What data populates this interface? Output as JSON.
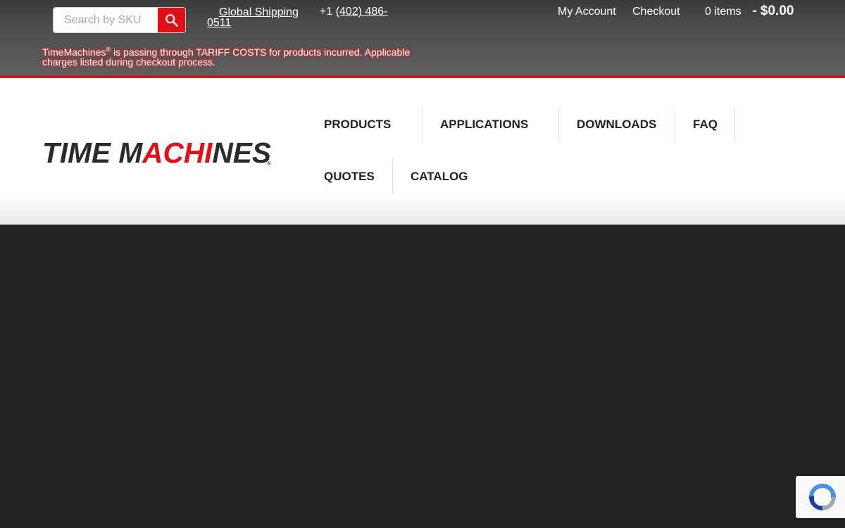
{
  "search": {
    "placeholder": "Search by SKU"
  },
  "topbar": {
    "shipping_label": "Global Shipping",
    "phone_prefix": "+1 ",
    "phone_number": "(402) 486-0511",
    "account_label": "My Account",
    "checkout_label": "Checkout",
    "cart_count": "0 items",
    "cart_separator": "-",
    "cart_total": "$0.00"
  },
  "notice": {
    "brand": "TimeMachines",
    "registered_mark": "®",
    "message": " is passing through TARIFF COSTS for products incurred. Applicable charges listed during checkout process."
  },
  "logo": {
    "part1": "TIME M",
    "part2": "ACHI",
    "part3": "NES",
    "registered_mark": "®"
  },
  "nav": {
    "items": [
      {
        "label": "PRODUCTS"
      },
      {
        "label": "APPLICATIONS"
      },
      {
        "label": "DOWNLOADS"
      },
      {
        "label": "FAQ"
      },
      {
        "label": "QUOTES"
      },
      {
        "label": "CATALOG"
      }
    ]
  },
  "colors": {
    "accent": "#e10f17",
    "topbar_border": "#d4141c",
    "page_background": "#222222",
    "nav_text": "#222222"
  },
  "icons": {
    "search": "search-icon",
    "recaptcha": "recaptcha-icon"
  }
}
